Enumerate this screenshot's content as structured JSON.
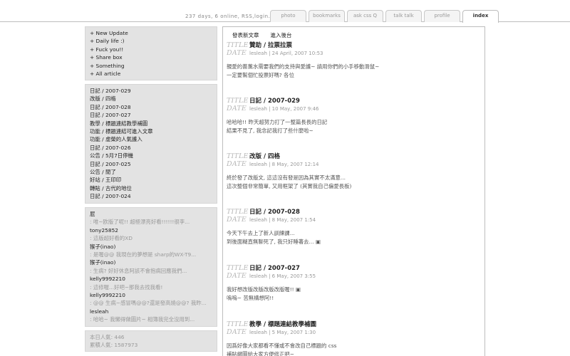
{
  "header": {
    "status": "237 days, 6 online, RSS,login..",
    "tabs": [
      {
        "label": "photo",
        "active": false
      },
      {
        "label": "bookmarks",
        "active": false
      },
      {
        "label": "ask css Q",
        "active": false
      },
      {
        "label": "talk talk",
        "active": false
      },
      {
        "label": "profile",
        "active": false
      },
      {
        "label": "index",
        "active": true
      }
    ]
  },
  "sidebar": {
    "menu": [
      "+ New Update",
      "+ Daily life :)",
      "+ Fuck you!!",
      "+ Share box",
      "+ Something",
      "+ All article"
    ],
    "recent": [
      "日記 / 2007-029",
      "改版 / 四格",
      "日記 / 2007-028",
      "日記 / 2007-027",
      "教學 / 標題連結教學補圖",
      "功能 / 標題連結可進入文章",
      "功能 / 虛榮的人氣護入",
      "日記 / 2007-026",
      "公告 / 5月7日停機",
      "日記 / 2007-025",
      "公告 / 閒了",
      "好站 / 王印印",
      "轉貼 / 古代的地位",
      "日記 / 2007-024"
    ],
    "comments": [
      {
        "text": "屁",
        "quote": false
      },
      {
        "text": ": 唯~欧版了呢!! 超極漂亮好看!!!!!!很李...",
        "quote": true
      },
      {
        "text": "tony25852",
        "quote": false
      },
      {
        "text": ": 這版超好看的XD",
        "quote": true
      },
      {
        "text": "猴子(inao)",
        "quote": false
      },
      {
        "text": ": 是喔@@ 我現在的夢想是 sharp的WX-T9...",
        "quote": true
      },
      {
        "text": "猴子(inao)",
        "quote": false
      },
      {
        "text": ": 生病? 好好休息阿該不會抱病回應我們...",
        "quote": true
      },
      {
        "text": "kelly9992210",
        "quote": false
      },
      {
        "text": ": 這修喔...好吧~那我去找我看!",
        "quote": true
      },
      {
        "text": "kelly9992210",
        "quote": false
      },
      {
        "text": ": @@ 生病~感冒嗎@@?還是發高燒@@? 我昨...",
        "quote": true
      },
      {
        "text": "lesleah",
        "quote": false
      },
      {
        "text": ": 哈哈~ 我懶得做圖片~ 相簿我完全沒用到...",
        "quote": true
      }
    ],
    "stats": [
      "本日人氣: 446",
      "累積人氣: 1587973"
    ]
  },
  "main": {
    "links": [
      "發表新文章",
      "進入後台"
    ],
    "title_label": "TITLE",
    "date_label": "DATE",
    "posts": [
      {
        "title": "贊助 / 拉票拉票",
        "date": "lesleah | 24 April, 2007 10:53",
        "lines": [
          "親愛的薔薰水需要我們的支持與愛護~ 請用你們的小手移動滑鼠~",
          "一定要幫個忙投票好嗎? 各位"
        ]
      },
      {
        "title": "日記 / 2007-029",
        "date": "lesleah | 10 May, 2007 9:46",
        "lines": [
          "哈哈哈!! 昨天超努力打了一整篇長長的日記",
          "結果不見了, 我念記我打了些什麼啦~"
        ]
      },
      {
        "title": "改版 / 四格",
        "date": "lesleah | 8 May, 2007 12:14",
        "lines": [
          "終於發了改版文, 這這沒有發是因為其實不太滿意...",
          "這次整個非常簡單, 又用框架了 (其實我自己偏愛長板)"
        ]
      },
      {
        "title": "日記 / 2007-028",
        "date": "lesleah | 8 May, 2007 1:54",
        "lines": [
          "今天下午去上了新人訓練課...",
          "到後面糊直無聊死了, 我只好睡著去... ▣"
        ]
      },
      {
        "title": "日記 / 2007-027",
        "date": "lesleah | 6 May, 2007 3:55",
        "lines": [
          "我好想改版改版改版改版喔!! ▣",
          "嗚嗚~ 苦無構想阿!!"
        ]
      },
      {
        "title": "教學 / 標題連結教學補圖",
        "date": "lesleah | 5 May, 2007 1:30",
        "lines": [
          "因爲好像大家都看不懂或不會改自己標題的 css",
          "補貼網圖給大家方便修正吧~"
        ]
      }
    ]
  }
}
